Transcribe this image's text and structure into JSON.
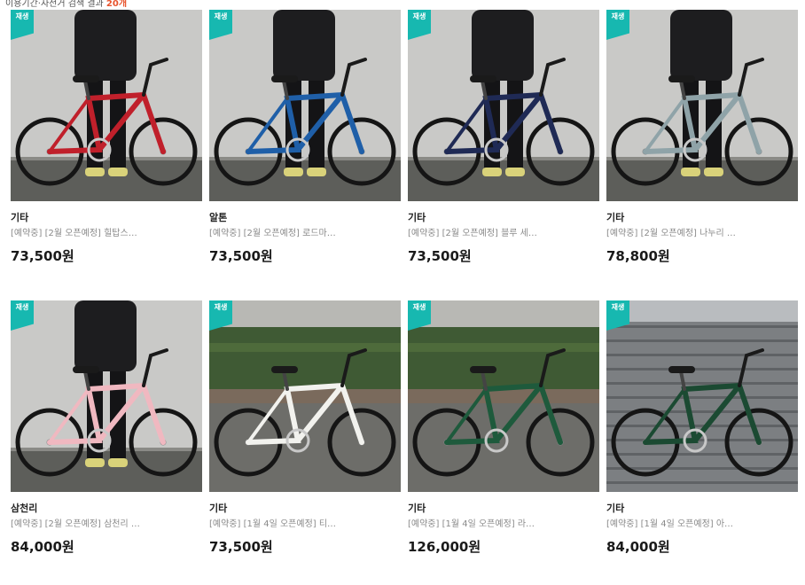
{
  "header": {
    "text": "이용기간·자전거 검색 결과 ",
    "count": "20개"
  },
  "badge_label": "재생",
  "accent_color": "#17b8b0",
  "products": [
    {
      "brand": "기타",
      "desc": "[예약중] [2월 오픈예정] 힐탑스…",
      "price": "73,500원",
      "bike_color": "#c0202b",
      "scene": "wall"
    },
    {
      "brand": "알톤",
      "desc": "[예약중] [2월 오픈예정] 로드마…",
      "price": "73,500원",
      "bike_color": "#1f5fa8",
      "scene": "wall"
    },
    {
      "brand": "기타",
      "desc": "[예약중] [2월 오픈예정] 블루 세…",
      "price": "73,500원",
      "bike_color": "#1f2a55",
      "scene": "wall"
    },
    {
      "brand": "기타",
      "desc": "[예약중] [2월 오픈예정] 나누리 …",
      "price": "78,800원",
      "bike_color": "#8fa3a8",
      "scene": "wall"
    },
    {
      "brand": "삼천리",
      "desc": "[예약중] [2월 오픈예정] 삼천리 …",
      "price": "84,000원",
      "bike_color": "#f0b8c0",
      "scene": "wall"
    },
    {
      "brand": "기타",
      "desc": "[예약중] [1월 4일 오픈예정] 티…",
      "price": "73,500원",
      "bike_color": "#f2f2ee",
      "scene": "hedge"
    },
    {
      "brand": "기타",
      "desc": "[예약중] [1월 4일 오픈예정] 라…",
      "price": "126,000원",
      "bike_color": "#1e5a3c",
      "scene": "hedge"
    },
    {
      "brand": "기타",
      "desc": "[예약중] [1월 4일 오픈예정] 아…",
      "price": "84,000원",
      "bike_color": "#1b4a32",
      "scene": "stairs"
    }
  ]
}
